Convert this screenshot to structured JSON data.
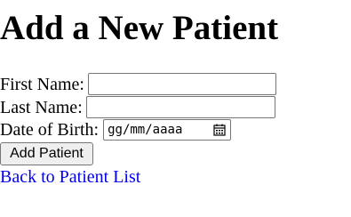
{
  "heading": "Add a New Patient",
  "form": {
    "first_name": {
      "label": "First Name:",
      "value": ""
    },
    "last_name": {
      "label": "Last Name:",
      "value": ""
    },
    "date_of_birth": {
      "label": "Date of Birth:",
      "placeholder": "gg/mm/aaaa",
      "icon": "calendar-icon"
    },
    "submit_label": "Add Patient"
  },
  "back_link": "Back to Patient List",
  "colors": {
    "link": "#0000ee",
    "button_bg": "#efefef",
    "input_border": "#767676"
  }
}
